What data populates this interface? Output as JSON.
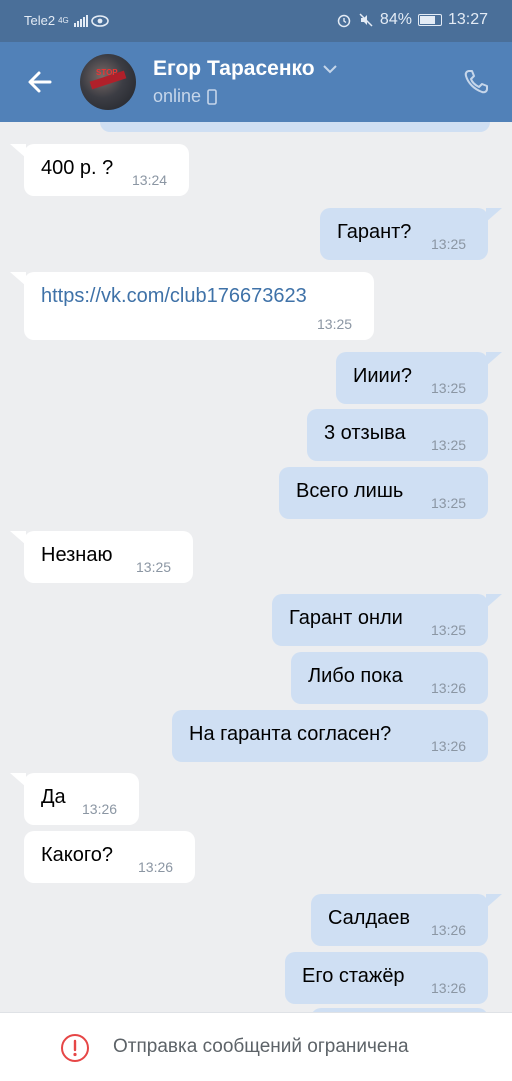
{
  "status_bar": {
    "carrier": "Tele2",
    "network": "4G",
    "battery": "84%",
    "time": "13:27"
  },
  "header": {
    "contact_name": "Егор Тарасенко",
    "presence": "online"
  },
  "messages": [
    {
      "dir": "in",
      "text": "400 р. ?",
      "time": "13:24"
    },
    {
      "dir": "out",
      "text": "Гарант?",
      "time": "13:25"
    },
    {
      "dir": "in",
      "text": "https://vk.com/club176673623",
      "time": "13:25"
    },
    {
      "dir": "out",
      "text": "Ииии?",
      "time": "13:25"
    },
    {
      "dir": "out",
      "text": "3 отзыва",
      "time": "13:25"
    },
    {
      "dir": "out",
      "text": "Всего лишь",
      "time": "13:25"
    },
    {
      "dir": "in",
      "text": "Незнаю",
      "time": "13:25"
    },
    {
      "dir": "out",
      "text": "Гарант онли",
      "time": "13:25"
    },
    {
      "dir": "out",
      "text": "Либо пока",
      "time": "13:26"
    },
    {
      "dir": "out",
      "text": "На гаранта согласен?",
      "time": "13:26"
    },
    {
      "dir": "in",
      "text": "Да",
      "time": "13:26"
    },
    {
      "dir": "in",
      "text": "Какого?",
      "time": "13:26"
    },
    {
      "dir": "out",
      "text": "Салдаев",
      "time": "13:26"
    },
    {
      "dir": "out",
      "text": "Его стажёр",
      "time": "13:26"
    }
  ],
  "footer": {
    "notice": "Отправка сообщений ограничена"
  },
  "colors": {
    "header": "#5181b8",
    "statusbar": "#4a6f99",
    "outgoing_bubble": "#cfdff3",
    "incoming_bubble": "#ffffff",
    "link": "#3f72a8"
  }
}
